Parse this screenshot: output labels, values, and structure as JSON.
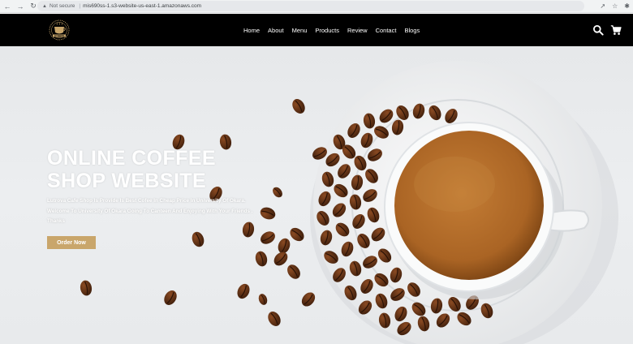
{
  "browser": {
    "security_label": "Not secure",
    "url": "mis690ss-1.s3-website-us-east-1.amazonaws.com"
  },
  "header": {
    "logo_text": "LUTROVA",
    "nav": [
      "Home",
      "About",
      "Menu",
      "Products",
      "Review",
      "Contact",
      "Blogs"
    ]
  },
  "hero": {
    "title_line1": "ONLINE COFFEE",
    "title_line2": "SHOP WEBSITE",
    "description": "Lutrova Cafe Shop Is Provide Is Best Cofee In Cheap Price In University Of Okara. Welcome To University Of Okara Going To Canteen And Enjoying With Your Friends . Thanks",
    "button_label": "Order Now"
  },
  "colors": {
    "header_bg": "#000000",
    "accent": "#c9a66b",
    "coffee": "#b06a2a"
  }
}
